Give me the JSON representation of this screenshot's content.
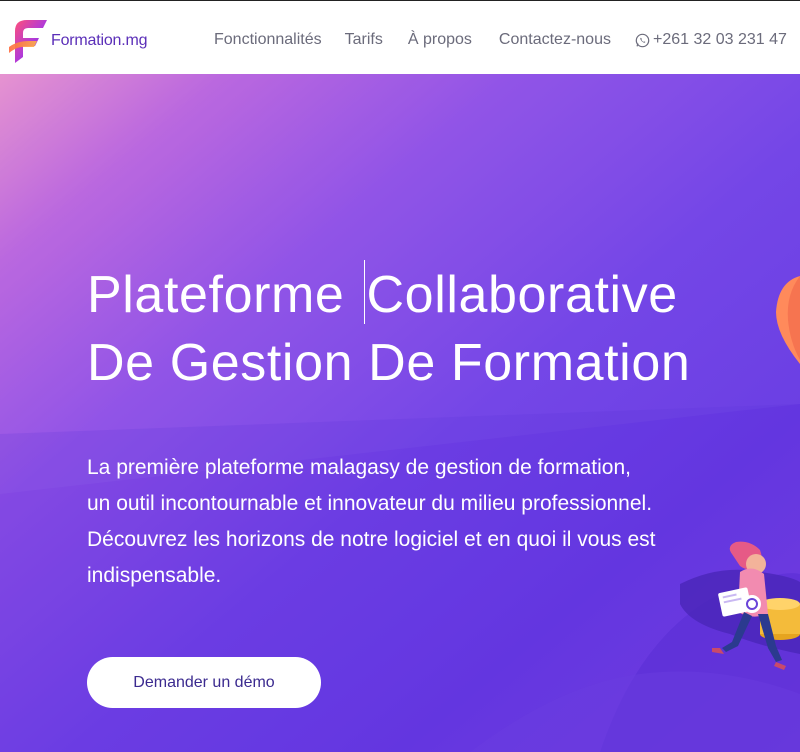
{
  "brand": {
    "name": "Formation.mg"
  },
  "nav": {
    "links": [
      {
        "label": "Fonctionnalités"
      },
      {
        "label": "Tarifs"
      },
      {
        "label": "À propos"
      },
      {
        "label": "Contactez-nous"
      }
    ],
    "phone": "+261 32 03 231 47"
  },
  "hero": {
    "title_part1": "Plateforme",
    "title_part2": "Collaborative",
    "title_line2": "De Gestion De Formation",
    "description": [
      "La première plateforme malagasy de gestion de formation,",
      "un outil incontournable et innovateur du milieu professionnel.",
      "Découvrez les horizons de notre logiciel et en quoi il vous est",
      "indispensable."
    ],
    "cta": "Demander un démo"
  },
  "colors": {
    "brand_purple": "#5b2fb8",
    "hero_gradient_start": "#e58fcf",
    "hero_gradient_end": "#6638e2",
    "cta_text": "#3b2a8f"
  },
  "icons": {
    "phone": "whatsapp-icon",
    "logo": "formation-logo-icon"
  }
}
